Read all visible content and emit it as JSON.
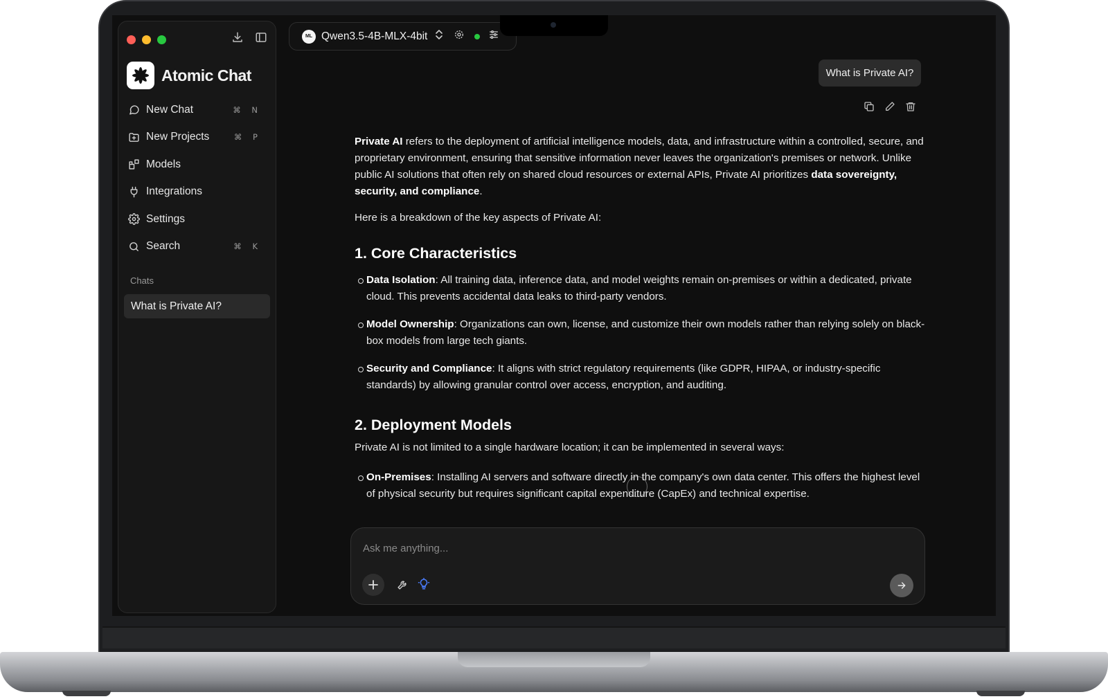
{
  "app": {
    "name": "Atomic Chat"
  },
  "sidebar": {
    "items": [
      {
        "label": "New Chat",
        "shortcut": "⌘ N",
        "icon": "chat-bubble-icon"
      },
      {
        "label": "New Projects",
        "shortcut": "⌘ P",
        "icon": "folder-plus-icon"
      },
      {
        "label": "Models",
        "shortcut": "",
        "icon": "blocks-icon"
      },
      {
        "label": "Integrations",
        "shortcut": "",
        "icon": "plug-icon"
      },
      {
        "label": "Settings",
        "shortcut": "",
        "icon": "gear-icon"
      },
      {
        "label": "Search",
        "shortcut": "⌘ K",
        "icon": "search-icon"
      }
    ],
    "chats_label": "Chats",
    "chats": [
      "What is Private AI?"
    ]
  },
  "model_bar": {
    "badge": "ML",
    "model_name": "Qwen3.5-4B-MLX-4bit",
    "status_color": "#28c840"
  },
  "chat": {
    "user_message": "What is Private AI?",
    "answer": {
      "intro_bold": "Private AI",
      "intro_text": " refers to the deployment of artificial intelligence models, data, and infrastructure within a controlled, secure, and proprietary environment, ensuring that sensitive information never leaves the organization's premises or network. Unlike public AI solutions that often rely on shared cloud resources or external APIs, Private AI prioritizes ",
      "intro_bold2": "data sovereignty, security, and compliance",
      "intro_end": ".",
      "breakdown": "Here is a breakdown of the key aspects of Private AI:",
      "section1_title": "1. Core Characteristics",
      "section1_bullets": [
        {
          "term": "Data Isolation",
          "text": ": All training data, inference data, and model weights remain on-premises or within a dedicated, private cloud. This prevents accidental data leaks to third-party vendors."
        },
        {
          "term": "Model Ownership",
          "text": ": Organizations can own, license, and customize their own models rather than relying solely on black-box models from large tech giants."
        },
        {
          "term": "Security and Compliance",
          "text": ": It aligns with strict regulatory requirements (like GDPR, HIPAA, or industry-specific standards) by allowing granular control over access, encryption, and auditing."
        }
      ],
      "section2_title": "2. Deployment Models",
      "section2_intro": "Private AI is not limited to a single hardware location; it can be implemented in several ways:",
      "section2_bullets": [
        {
          "term": "On-Premises",
          "text": ": Installing AI servers and software directly in the company's own data center. This offers the highest level of physical security but requires significant capital expenditure (CapEx) and technical expertise."
        }
      ]
    }
  },
  "composer": {
    "placeholder": "Ask me anything..."
  },
  "colors": {
    "background": "#0f0f0f",
    "sidebar": "#171717",
    "accent_blue": "#4a7dff"
  }
}
